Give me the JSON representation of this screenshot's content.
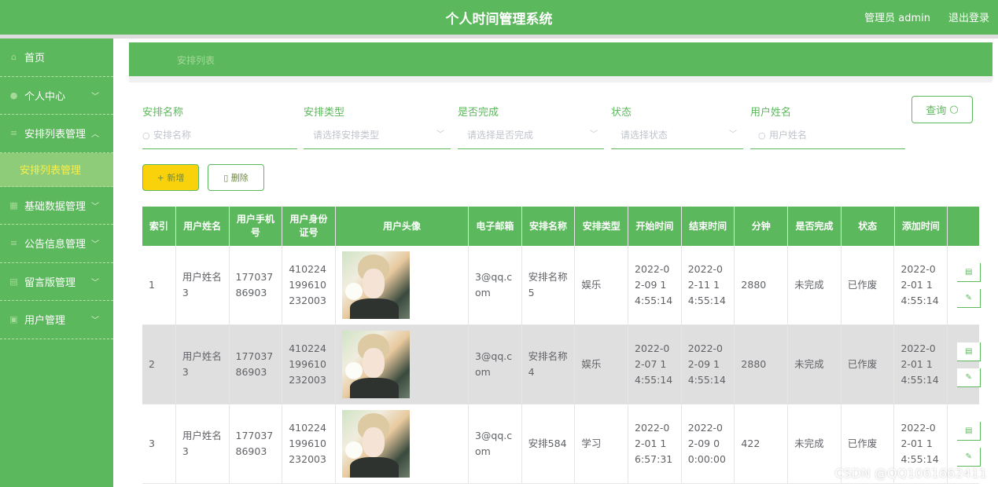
{
  "header": {
    "title": "个人时间管理系统",
    "user_label": "管理员 admin",
    "logout_label": "退出登录"
  },
  "sidebar": {
    "items": [
      {
        "label": "首页",
        "icon": "home-icon"
      },
      {
        "label": "个人中心",
        "icon": "user-icon",
        "arrow": "﹀"
      },
      {
        "label": "安排列表管理",
        "icon": "list-icon",
        "arrow": "︿"
      },
      {
        "label": "安排列表管理",
        "sub": true
      },
      {
        "label": "基础数据管理",
        "icon": "grid-icon",
        "arrow": "﹀"
      },
      {
        "label": "公告信息管理",
        "icon": "list-icon",
        "arrow": "﹀"
      },
      {
        "label": "留言版管理",
        "icon": "message-icon",
        "arrow": "﹀"
      },
      {
        "label": "用户管理",
        "icon": "users-icon",
        "arrow": "﹀"
      }
    ]
  },
  "breadcrumb": "安排列表",
  "search": {
    "fields": [
      {
        "label": "安排名称",
        "placeholder": "安排名称",
        "kind": "text"
      },
      {
        "label": "安排类型",
        "placeholder": "请选择安排类型",
        "kind": "select"
      },
      {
        "label": "是否完成",
        "placeholder": "请选择是否完成",
        "kind": "select"
      },
      {
        "label": "状态",
        "placeholder": "请选择状态",
        "kind": "select"
      },
      {
        "label": "用户姓名",
        "placeholder": "用户姓名",
        "kind": "text"
      }
    ],
    "query_label": "查询"
  },
  "actions": {
    "add_label": "新增",
    "delete_label": "删除"
  },
  "table": {
    "columns": [
      "索引",
      "用户姓名",
      "用户手机号",
      "用户身份证号",
      "用户头像",
      "电子邮箱",
      "安排名称",
      "安排类型",
      "开始时间",
      "结束时间",
      "分钟",
      "是否完成",
      "状态",
      "添加时间",
      ""
    ],
    "rows": [
      {
        "index": "1",
        "name": "用户姓名3",
        "phone": "17703786903",
        "idcard": "410224199610232003",
        "email": "3@qq.com",
        "plan": "安排名称5",
        "type": "娱乐",
        "start": "2022-02-09 14:55:14",
        "end": "2022-02-11 14:55:14",
        "minutes": "2880",
        "done": "未完成",
        "status": "已作废",
        "added": "2022-02-01 14:55:14"
      },
      {
        "index": "2",
        "name": "用户姓名3",
        "phone": "17703786903",
        "idcard": "410224199610232003",
        "email": "3@qq.com",
        "plan": "安排名称4",
        "type": "娱乐",
        "start": "2022-02-07 14:55:14",
        "end": "2022-02-09 14:55:14",
        "minutes": "2880",
        "done": "未完成",
        "status": "已作废",
        "added": "2022-02-01 14:55:14"
      },
      {
        "index": "3",
        "name": "用户姓名3",
        "phone": "17703786903",
        "idcard": "410224199610232003",
        "email": "3@qq.com",
        "plan": "安排584",
        "type": "学习",
        "start": "2022-02-01 16:57:31",
        "end": "2022-02-09 00:00:00",
        "minutes": "422",
        "done": "未完成",
        "status": "已作废",
        "added": "2022-02-01 14:55:14"
      }
    ]
  },
  "watermark": "CSDN @QQ1061662411",
  "colors": {
    "primary": "#5cb85c",
    "add_button": "#fad20b",
    "accent_text": "#f7ef4a"
  }
}
